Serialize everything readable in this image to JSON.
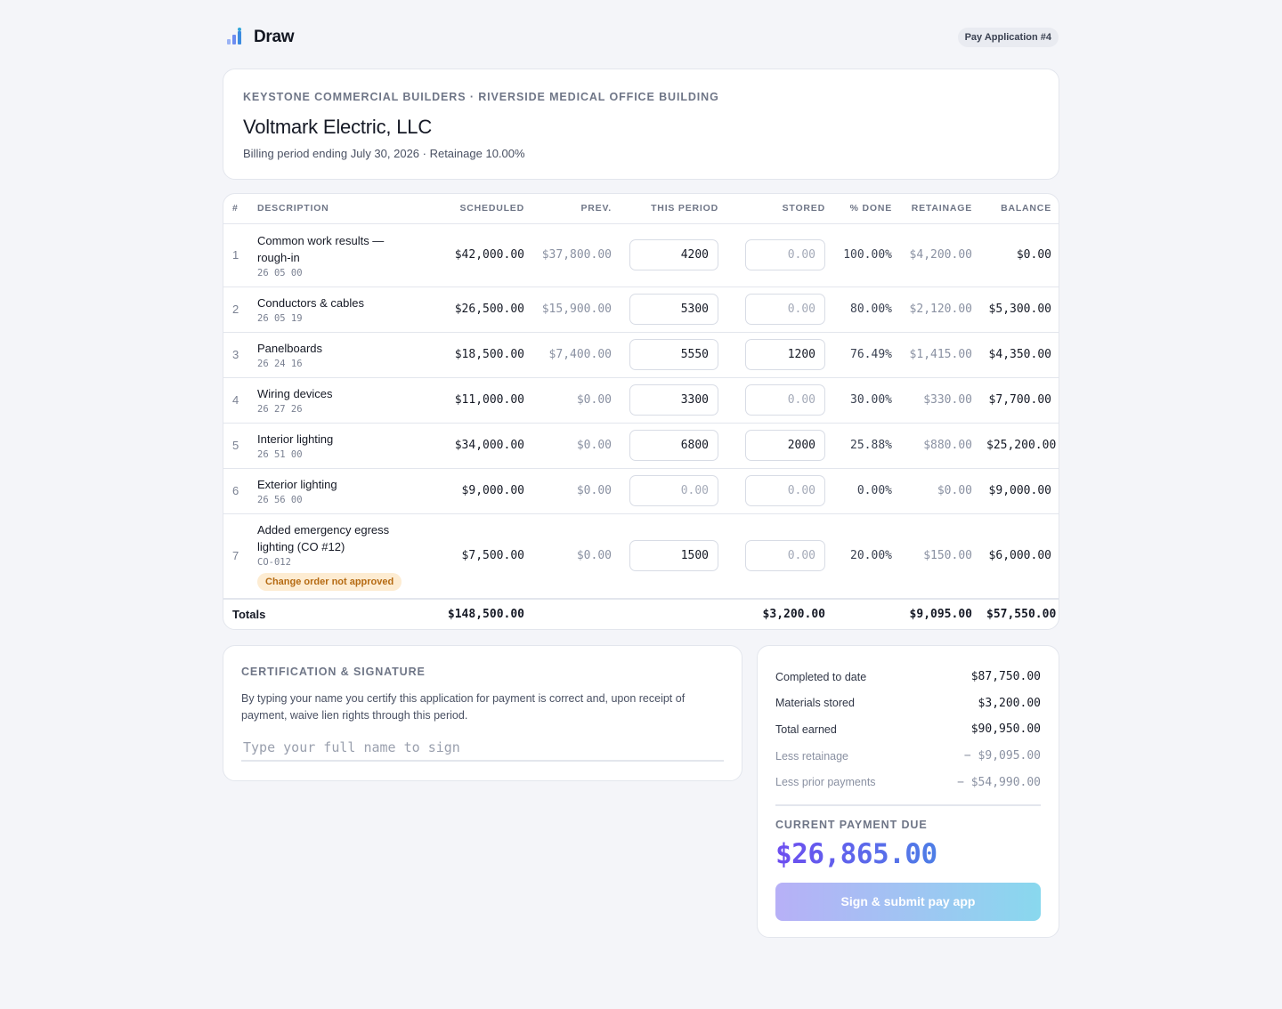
{
  "header": {
    "brand": "Draw",
    "pill": "Pay Application #4"
  },
  "project": {
    "overline": "Keystone Commercial Builders · Riverside Medical Office Building",
    "subcontractor": "Voltmark Electric, LLC",
    "billing": "Billing period ending July 30, 2026 · Retainage 10.00%"
  },
  "table": {
    "columns": [
      "#",
      "DESCRIPTION",
      "SCHEDULED",
      "PREV.",
      "THIS PERIOD",
      "STORED",
      "% DONE",
      "RETAINAGE",
      "BALANCE"
    ],
    "rows": [
      {
        "num": "1",
        "title": "Common work results — rough-in",
        "code": "26 05 00",
        "scheduled": "$42,000.00",
        "prev": "$37,800.00",
        "this_period": "4200",
        "stored": "0.00",
        "done": "100.00%",
        "retainage": "$4,200.00",
        "balance": "$0.00"
      },
      {
        "num": "2",
        "title": "Conductors & cables",
        "code": "26 05 19",
        "scheduled": "$26,500.00",
        "prev": "$15,900.00",
        "this_period": "5300",
        "stored": "0.00",
        "done": "80.00%",
        "retainage": "$2,120.00",
        "balance": "$5,300.00"
      },
      {
        "num": "3",
        "title": "Panelboards",
        "code": "26 24 16",
        "scheduled": "$18,500.00",
        "prev": "$7,400.00",
        "this_period": "5550",
        "stored": "1200",
        "done": "76.49%",
        "retainage": "$1,415.00",
        "balance": "$4,350.00"
      },
      {
        "num": "4",
        "title": "Wiring devices",
        "code": "26 27 26",
        "scheduled": "$11,000.00",
        "prev": "$0.00",
        "this_period": "3300",
        "stored": "0.00",
        "done": "30.00%",
        "retainage": "$330.00",
        "balance": "$7,700.00"
      },
      {
        "num": "5",
        "title": "Interior lighting",
        "code": "26 51 00",
        "scheduled": "$34,000.00",
        "prev": "$0.00",
        "this_period": "6800",
        "stored": "2000",
        "done": "25.88%",
        "retainage": "$880.00",
        "balance": "$25,200.00"
      },
      {
        "num": "6",
        "title": "Exterior lighting",
        "code": "26 56 00",
        "scheduled": "$9,000.00",
        "prev": "$0.00",
        "this_period": "0.00",
        "stored": "0.00",
        "done": "0.00%",
        "retainage": "$0.00",
        "balance": "$9,000.00"
      },
      {
        "num": "7",
        "title": "Added emergency egress lighting (CO #12)",
        "code": "CO-012",
        "badge": "Change order not approved",
        "scheduled": "$7,500.00",
        "prev": "$0.00",
        "this_period": "1500",
        "stored": "0.00",
        "done": "20.00%",
        "retainage": "$150.00",
        "balance": "$6,000.00"
      }
    ],
    "totals": {
      "label": "Totals",
      "scheduled": "$148,500.00",
      "stored": "$3,200.00",
      "retainage": "$9,095.00",
      "balance": "$57,550.00"
    }
  },
  "certification": {
    "title": "Certification & Signature",
    "text": "By typing your name you certify this application for payment is correct and, upon receipt of payment, waive lien rights through this period.",
    "placeholder": "Type your full name to sign"
  },
  "summary": {
    "rows": [
      {
        "label": "Completed to date",
        "value": "$87,750.00"
      },
      {
        "label": "Materials stored",
        "value": "$3,200.00"
      },
      {
        "label": "Total earned",
        "value": "$90,950.00"
      },
      {
        "label": "Less retainage",
        "value": "− $9,095.00"
      },
      {
        "label": "Less prior payments",
        "value": "− $54,990.00"
      }
    ],
    "due_label": "Current payment due",
    "due_amount": "$26,865.00",
    "submit_label": "Sign & submit pay app"
  }
}
